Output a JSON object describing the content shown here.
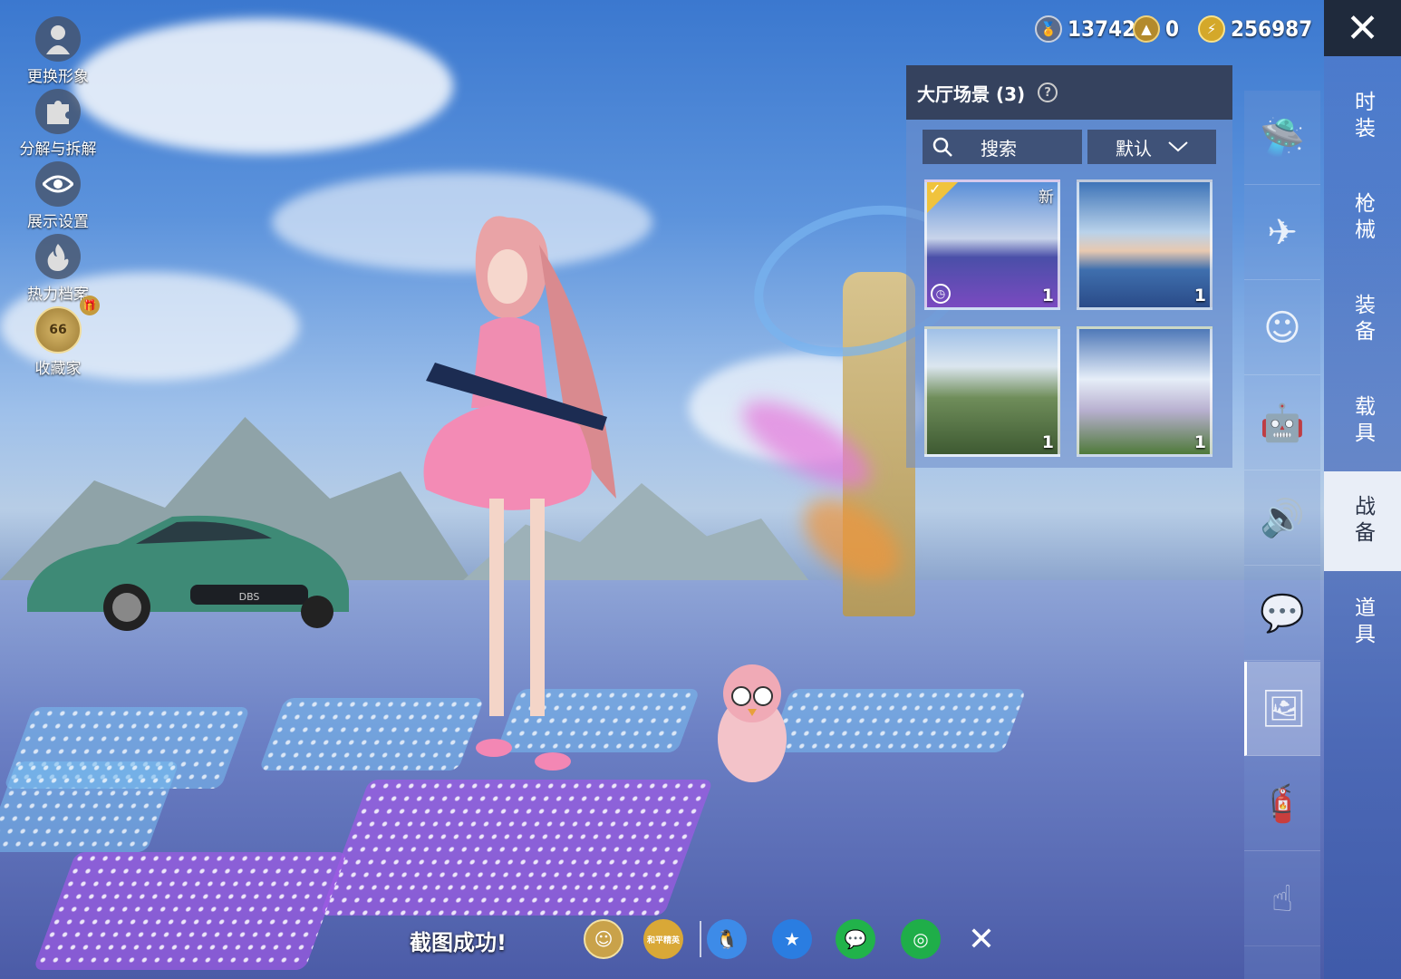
{
  "left_menu": [
    {
      "label": "更换形象",
      "icon": "avatar-icon"
    },
    {
      "label": "分解与拆解",
      "icon": "puzzle-icon"
    },
    {
      "label": "展示设置",
      "icon": "eye-icon"
    },
    {
      "label": "热力档案",
      "icon": "flame-icon"
    },
    {
      "label": "收藏家",
      "icon": "collector-badge-icon",
      "badge": "66"
    }
  ],
  "currencies": [
    {
      "icon": "medal-coin-icon",
      "value": "13742",
      "color": "#5a6b8c"
    },
    {
      "icon": "gold-token-icon",
      "value": "0",
      "color": "#b38a2c"
    },
    {
      "icon": "lightning-coin-icon",
      "value": "256987",
      "color": "#d4a82a"
    }
  ],
  "scene_panel": {
    "title": "大厅场景 (3)",
    "search_label": "搜索",
    "sort_label": "默认",
    "scenes": [
      {
        "count": "1",
        "new_label": "新",
        "selected": true,
        "timed": true
      },
      {
        "count": "1"
      },
      {
        "count": "1"
      },
      {
        "count": "1"
      }
    ]
  },
  "right_tabs": [
    {
      "label": "时装"
    },
    {
      "label": "枪械"
    },
    {
      "label": "装备"
    },
    {
      "label": "载具"
    },
    {
      "label": "战备",
      "active": true
    },
    {
      "label": "道具"
    }
  ],
  "icon_column": [
    {
      "icon": "drone-icon"
    },
    {
      "icon": "airplane-icon"
    },
    {
      "icon": "emote-face-icon"
    },
    {
      "icon": "robot-pet-icon"
    },
    {
      "icon": "speaker-icon"
    },
    {
      "icon": "chat-bubble-icon"
    },
    {
      "icon": "gallery-icon",
      "active": true
    },
    {
      "icon": "spray-can-icon"
    },
    {
      "icon": "tap-gesture-icon"
    }
  ],
  "share_bar": {
    "status": "截图成功!",
    "brand_text": "和平精英",
    "items": [
      {
        "icon": "game-center-icon",
        "color": "#c9a24a"
      },
      {
        "icon": "game-logo-icon",
        "color": "#d9a837"
      },
      {
        "icon": "qq-icon",
        "color": "#3d8be8"
      },
      {
        "icon": "qzone-icon",
        "color": "#2a7de1"
      },
      {
        "icon": "wechat-icon",
        "color": "#21b34a"
      },
      {
        "icon": "moments-icon",
        "color": "#1fae49"
      }
    ]
  }
}
